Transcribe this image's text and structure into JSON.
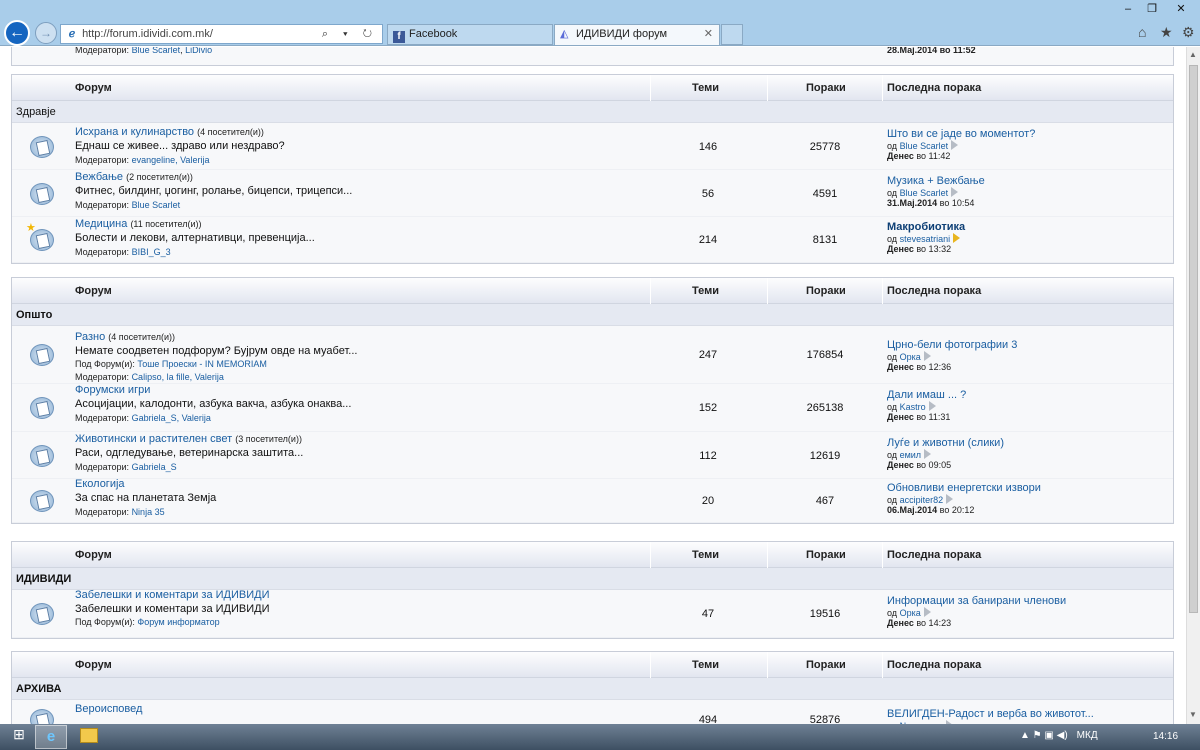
{
  "browser": {
    "address": "http://forum.idividi.com.mk/",
    "address_controls": "⌕ ▾ ↻",
    "tabs": [
      {
        "label": "Facebook"
      },
      {
        "label": "ИДИВИДИ форум"
      }
    ],
    "tools": {
      "home": "⌂",
      "favorites": "★",
      "settings": "⚙"
    },
    "window": {
      "minimize": "–",
      "maximize": "❐",
      "close": "✕"
    }
  },
  "top_partial": {
    "moderators_label": "Модератори:",
    "moderators": [
      "Blue Scarlet",
      "LiDivio"
    ],
    "date": "28.Мај.2014 во 11:52"
  },
  "header": {
    "forum": "Форум",
    "topics": "Теми",
    "posts": "Пораки",
    "last": "Последна порака"
  },
  "labels": {
    "moderators": "Модератори:",
    "subforums": "Под Форум(и):",
    "by": "од",
    "visitors_suffix": "посетител(и)"
  },
  "sections": [
    {
      "category": "Здравје",
      "forums": [
        {
          "name": "Исхрана и кулинарство",
          "visitors": "(4 посетител(и))",
          "desc": "Еднаш се живее... здраво или нездраво?",
          "moderators": "evangeline, Valerija",
          "topics": "146",
          "posts": "25778",
          "last_title": "Што ви се јаде во моментот?",
          "last_by": "Blue Scarlet",
          "last_date": "Денес",
          "last_time": "во 11:42"
        },
        {
          "name": "Вежбање",
          "visitors": "(2 посетител(и))",
          "desc": "Фитнес, билдинг, џогинг, ролање, бицепси, трицепси...",
          "moderators": "Blue Scarlet",
          "topics": "56",
          "posts": "4591",
          "last_title": "Музика + Вежбање",
          "last_by": "Blue Scarlet",
          "last_date": "31.Мај.2014",
          "last_time": "во 10:54"
        },
        {
          "name": "Медицина",
          "visitors": "(11 посетител(и))",
          "desc": "Болести и лекови, алтернативци, превенција...",
          "moderators": "BIBI_G_3",
          "topics": "214",
          "posts": "8131",
          "last_title": "Макробиотика",
          "last_by": "stevesatriani",
          "last_date": "Денес",
          "last_time": "во 13:32"
        }
      ]
    },
    {
      "category": "Општо",
      "forums": [
        {
          "name": "Разно",
          "visitors": "(4 посетител(и))",
          "desc": "Немате соодветен подфорум? Бујрум овде на муабет...",
          "subforum": "Тоше Проески - IN MEMORIAM",
          "moderators": "Calipso, la fille, Valerija",
          "topics": "247",
          "posts": "176854",
          "last_title": "Црно-бели фотографии 3",
          "last_by": "Орка",
          "last_date": "Денес",
          "last_time": "во 12:36"
        },
        {
          "name": "Форумски игри",
          "desc": "Асоцијации, калодонти, азбука вакча, азбука онаква...",
          "moderators": "Gabriela_S, Valerija",
          "topics": "152",
          "posts": "265138",
          "last_title": "Дали имаш ... ?",
          "last_by": "Kastro",
          "last_date": "Денес",
          "last_time": "во 11:31"
        },
        {
          "name": "Животински и растителен свет",
          "visitors": "(3 посетител(и))",
          "desc": "Раси, одгледување, ветеринарска заштита...",
          "moderators": "Gabriela_S",
          "topics": "112",
          "posts": "12619",
          "last_title": "Луѓе и животни (слики)",
          "last_by": "емил",
          "last_date": "Денес",
          "last_time": "во 09:05"
        },
        {
          "name": "Екологија",
          "desc": "За спас на планетата Земја",
          "moderators": "Ninja 35",
          "topics": "20",
          "posts": "467",
          "last_title": "Обновливи енергетски извори",
          "last_by": "accipiter82",
          "last_date": "06.Мај.2014",
          "last_time": "во 20:12"
        }
      ]
    },
    {
      "category": "ИДИВИДИ",
      "forums": [
        {
          "name": "Забелешки и коментари за ИДИВИДИ",
          "desc": "Забелешки и коментари за ИДИВИДИ",
          "subforum": "Форум информатор",
          "topics": "47",
          "posts": "19516",
          "last_title": "Информации за банирани членови",
          "last_by": "Орка",
          "last_date": "Денес",
          "last_time": "во 14:23"
        }
      ]
    },
    {
      "category": "АРХИВА",
      "forums": [
        {
          "name": "Вероисповед",
          "topics": "494",
          "posts": "52876",
          "last_title": "ВЕЛИГДЕН-Радост и верба во животот...",
          "last_by": "Nessaraya"
        }
      ]
    }
  ],
  "taskbar": {
    "tray_lang": "МКД",
    "clock": "14:16",
    "tray_icons": "▲ ⚑ ▣ ◀)"
  }
}
